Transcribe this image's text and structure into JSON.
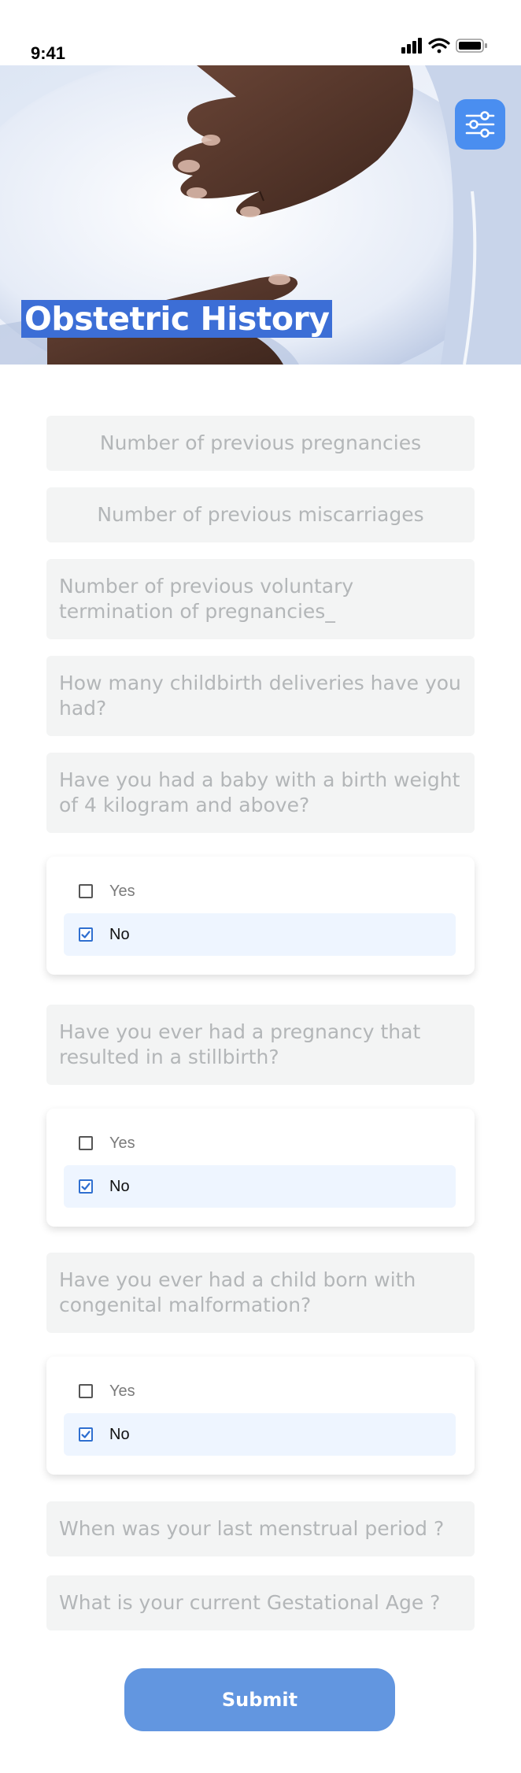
{
  "status_bar": {
    "time": "9:41"
  },
  "header": {
    "title": "Obstetric History",
    "filter_icon": "sliders-icon"
  },
  "form": {
    "fields": [
      {
        "placeholder": "Number of previous pregnancies"
      },
      {
        "placeholder": "Number of previous miscarriages"
      },
      {
        "placeholder": "Number of previous voluntary termination of pregnancies_"
      },
      {
        "placeholder": "How many childbirth deliveries have you had?"
      },
      {
        "placeholder": "Have you had a baby with a birth weight of 4 kilogram and above?"
      },
      {
        "placeholder": "Have you ever had a pregnancy that resulted in a stillbirth?"
      },
      {
        "placeholder": "Have you ever had a child born with congenital malformation?"
      },
      {
        "placeholder": "When was your last menstrual period ?"
      },
      {
        "placeholder": "What is your current Gestational Age ?"
      }
    ],
    "choices": [
      {
        "yes_label": "Yes",
        "no_label": "No",
        "selected": "No"
      },
      {
        "yes_label": "Yes",
        "no_label": "No",
        "selected": "No"
      },
      {
        "yes_label": "Yes",
        "no_label": "No",
        "selected": "No"
      }
    ],
    "submit_label": "Submit"
  },
  "colors": {
    "accent": "#3c6ed6",
    "submit": "#6296e0",
    "field_bg": "#f3f4f4",
    "selected_bg": "#eef5ff"
  }
}
